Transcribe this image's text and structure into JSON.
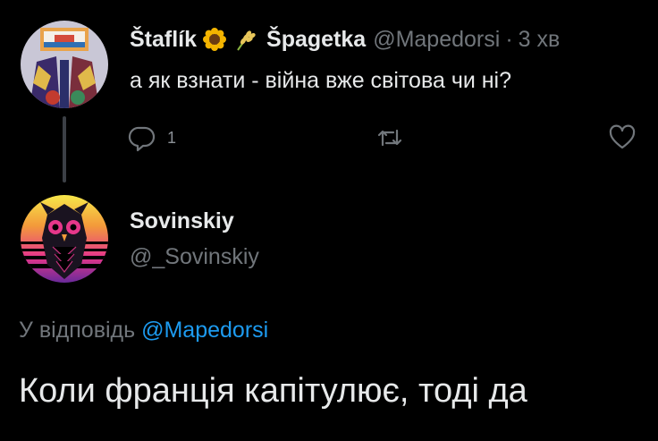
{
  "tweet1": {
    "display_name_1": "Štaflík",
    "display_name_2": "Špagetka",
    "handle": "@Mapedorsi",
    "separator": "·",
    "timestamp": "3 хв",
    "text": "а як взнати - війна вже світова чи ні?",
    "reply_count": "1",
    "emojis": [
      "sunflower-emoji",
      "wheat-emoji"
    ]
  },
  "tweet2": {
    "display_name": "Sovinskiy",
    "handle": "@_Sovinskiy",
    "reply_to_prefix": "У відповідь",
    "reply_to_mention": "@Mapedorsi",
    "text": "Коли франція капітулює, тоді да"
  },
  "colors": {
    "background": "#000000",
    "text_primary": "#e7e9ea",
    "text_secondary": "#71767b",
    "mention": "#1d9bf0",
    "thread_line": "#3c4046"
  },
  "icons": [
    "reply-icon",
    "retweet-icon",
    "like-icon"
  ]
}
